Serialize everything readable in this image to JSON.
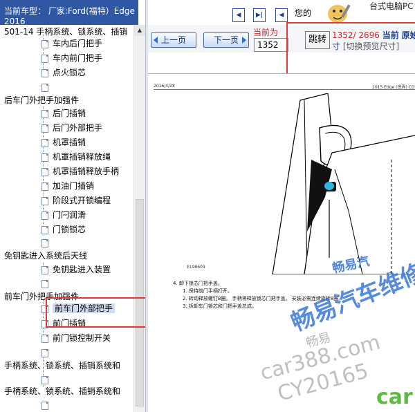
{
  "header": {
    "car_type": "当前车型：  厂家:Ford(福特）Edge（锐界）2015-",
    "car_type_line2": "2016"
  },
  "tree": {
    "top_section": "501-14 手柄系统、锁系统、插销",
    "top_items": [
      "车内后门把手",
      "车内前门把手",
      "点火锁芯"
    ],
    "rear_group": "后车门外把手加强件",
    "rear_items": [
      "后门插销",
      "后门外部把手",
      "机罩插销",
      "机罩插销释放绳",
      "机罩插销释放手柄",
      "加油门插销",
      "阶段式开锁编程",
      "门闩润滑",
      "门锁锁芯"
    ],
    "keyless_group": "免钥匙进入系统后天线",
    "keyless_items": [
      "免钥匙进入装置"
    ],
    "front_group": "前车门外把手加强件",
    "front_items": [
      "前车门外部把手",
      "前门插销",
      "前门锁控制开关"
    ],
    "bottom_items": [
      "手柄系统、锁系统、插销系统和",
      "手柄系统、锁系统、插销系统和"
    ]
  },
  "toolbar": {
    "hello": "您的",
    "promo": "台式电脑PC",
    "nav_buttons": [
      "◀",
      "▶|",
      "◀"
    ]
  },
  "pager": {
    "prev_label": "上一页",
    "next_label": "下一页",
    "current_label": "当前为",
    "current_page": "1352",
    "jump_label": "跳转",
    "page_info": "1352/ 2696",
    "page_info_suffix": "当前",
    "page_info_suffix2": "原始",
    "size_char": "寸",
    "size_switch": "[切换预览尺寸]"
  },
  "document": {
    "date": "2016/4/28",
    "title": "2015 Edge (锐界) CD",
    "figure_code": "E198609",
    "step_main": "4.  卸下锁芯门把手盖。",
    "steps": [
      "1.  保持前门手柄打开。",
      "2.  转动释放螺钉8圈。  手柄将释放锁芯门把手盖。  安装必需连续旋转8圈。",
      "3.  拆卸车门锁芯和门把手盖总成。"
    ]
  },
  "watermarks": {
    "brand_small": "畅易汽",
    "brand_big": "畅易汽车维修",
    "car_green": "car",
    "cn_grey": "畅易",
    "domain": "car388.com",
    "code": "CY20165"
  },
  "colors": {
    "header_bg": "#2f57a3",
    "accent_red": "#e21b1b",
    "link_blue": "#1d3e8a",
    "watermark_blue": "#2d6fd6",
    "watermark_green": "#4db32f"
  }
}
